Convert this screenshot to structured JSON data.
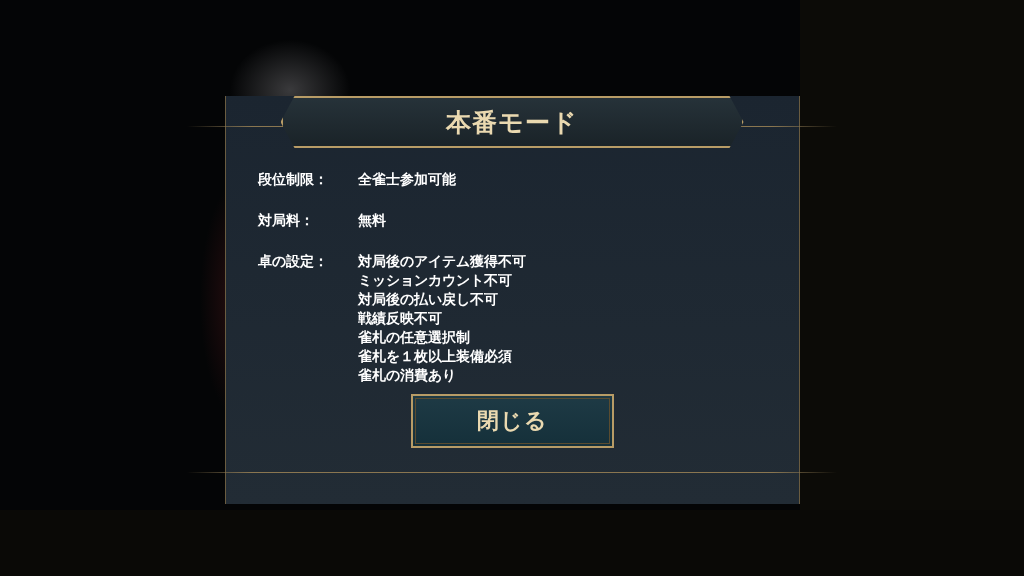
{
  "dialog": {
    "title": "本番モード",
    "rules": [
      {
        "label": "段位制限：",
        "values": [
          "全雀士参加可能"
        ]
      },
      {
        "label": "対局料：",
        "values": [
          "無料"
        ]
      },
      {
        "label": "卓の設定：",
        "values": [
          "対局後のアイテム獲得不可",
          "ミッションカウント不可",
          "対局後の払い戻し不可",
          "戦績反映不可",
          "雀札の任意選択制",
          "雀札を１枚以上装備必須",
          "雀札の消費あり"
        ]
      }
    ],
    "close_button": "閉じる"
  }
}
